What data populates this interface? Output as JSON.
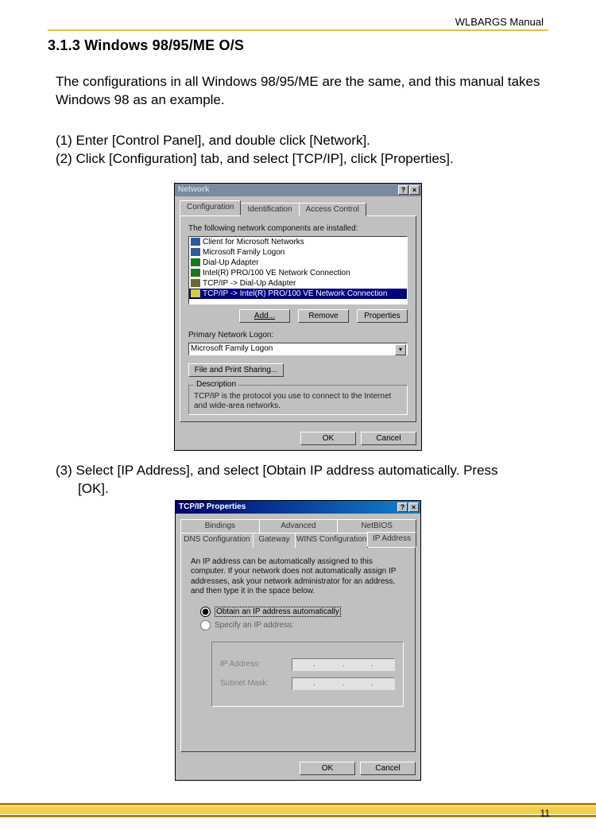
{
  "header": {
    "right": "WLBARGS Manual"
  },
  "section": {
    "title": "3.1.3 Windows 98/95/ME O/S",
    "intro": "The configurations in all Windows 98/95/ME are the same, and this manual takes Windows 98 as an example.",
    "step1": "(1) Enter [Control Panel], and double click [Network].",
    "step2": "(2) Click [Configuration] tab, and select [TCP/IP], click [Properties].",
    "step3a": "(3) Select [IP Address], and select [Obtain IP address automatically. Press",
    "step3b": "[OK]."
  },
  "dialog1": {
    "title": "Network",
    "help_btn": "?",
    "close_btn": "×",
    "tabs": {
      "t1": "Configuration",
      "t2": "Identification",
      "t3": "Access Control"
    },
    "list_label": "The following network components are installed:",
    "items": {
      "i0": "Client for Microsoft Networks",
      "i1": "Microsoft Family Logon",
      "i2": "Dial-Up Adapter",
      "i3": "Intel(R) PRO/100 VE Network Connection",
      "i4": "TCP/IP -> Dial-Up Adapter",
      "i5": "TCP/IP -> Intel(R) PRO/100 VE Network Connection"
    },
    "buttons": {
      "add": "Add...",
      "remove": "Remove",
      "properties": "Properties"
    },
    "primary_label": "Primary Network Logon:",
    "primary_value": "Microsoft Family Logon",
    "file_print": "File and Print Sharing...",
    "desc_title": "Description",
    "desc_text": "TCP/IP is the protocol you use to connect to the Internet and wide-area networks.",
    "ok": "OK",
    "cancel": "Cancel"
  },
  "dialog2": {
    "title": "TCP/IP Properties",
    "help_btn": "?",
    "close_btn": "×",
    "tabs_top": {
      "t1": "Bindings",
      "t2": "Advanced",
      "t3": "NetBIOS"
    },
    "tabs_bot": {
      "t4": "DNS Configuration",
      "t5": "Gateway",
      "t6": "WINS Configuration",
      "t7": "IP Address"
    },
    "explain": "An IP address can be automatically assigned to this computer. If your network does not automatically assign IP addresses, ask your network administrator for an address, and then type it in the space below.",
    "radio_auto": "Obtain an IP address automatically",
    "radio_manual": "Specify an IP address:",
    "ip_label": "IP Address:",
    "mask_label": "Subnet Mask:",
    "ok": "OK",
    "cancel": "Cancel"
  },
  "page_number": "11"
}
